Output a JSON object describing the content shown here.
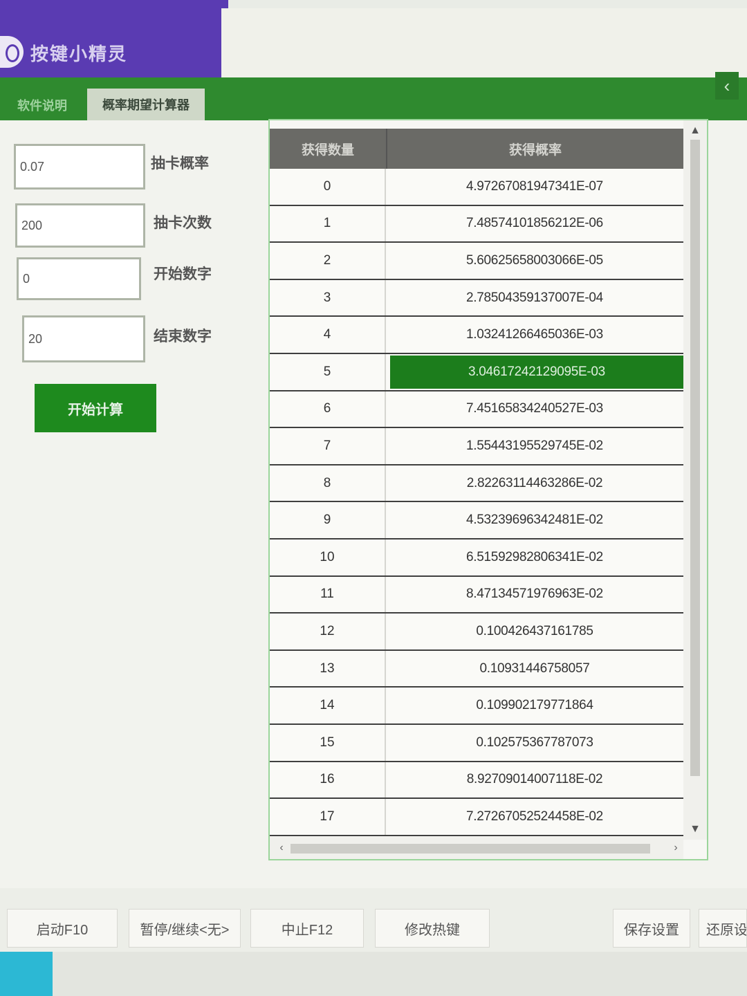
{
  "app": {
    "title": "按键小精灵"
  },
  "tabs": [
    {
      "label": "软件说明"
    },
    {
      "label": "概率期望计算器"
    }
  ],
  "form": {
    "probability": {
      "value": "0.07",
      "label": "抽卡概率"
    },
    "draws": {
      "value": "200",
      "label": "抽卡次数"
    },
    "start": {
      "value": "0",
      "label": "开始数字"
    },
    "end": {
      "value": "20",
      "label": "结束数字"
    },
    "calc_label": "开始计算"
  },
  "table": {
    "columns": [
      "获得数量",
      "获得概率"
    ],
    "selected_index": 5,
    "rows": [
      [
        "0",
        "4.97267081947341E-07"
      ],
      [
        "1",
        "7.48574101856212E-06"
      ],
      [
        "2",
        "5.60625658003066E-05"
      ],
      [
        "3",
        "2.78504359137007E-04"
      ],
      [
        "4",
        "1.03241266465036E-03"
      ],
      [
        "5",
        "3.04617242129095E-03"
      ],
      [
        "6",
        "7.45165834240527E-03"
      ],
      [
        "7",
        "1.55443195529745E-02"
      ],
      [
        "8",
        "2.82263114463286E-02"
      ],
      [
        "9",
        "4.53239696342481E-02"
      ],
      [
        "10",
        "6.51592982806341E-02"
      ],
      [
        "11",
        "8.47134571976963E-02"
      ],
      [
        "12",
        "0.100426437161785"
      ],
      [
        "13",
        "0.10931446758057"
      ],
      [
        "14",
        "0.109902179771864"
      ],
      [
        "15",
        "0.102575367787073"
      ],
      [
        "16",
        "8.92709014007118E-02"
      ],
      [
        "17",
        "7.27267052524458E-02"
      ]
    ]
  },
  "footer": {
    "start": "启动F10",
    "pause": "暂停/继续<无>",
    "stop": "中止F12",
    "hotkey": "修改热键",
    "save": "保存设置",
    "restore": "还原设"
  }
}
